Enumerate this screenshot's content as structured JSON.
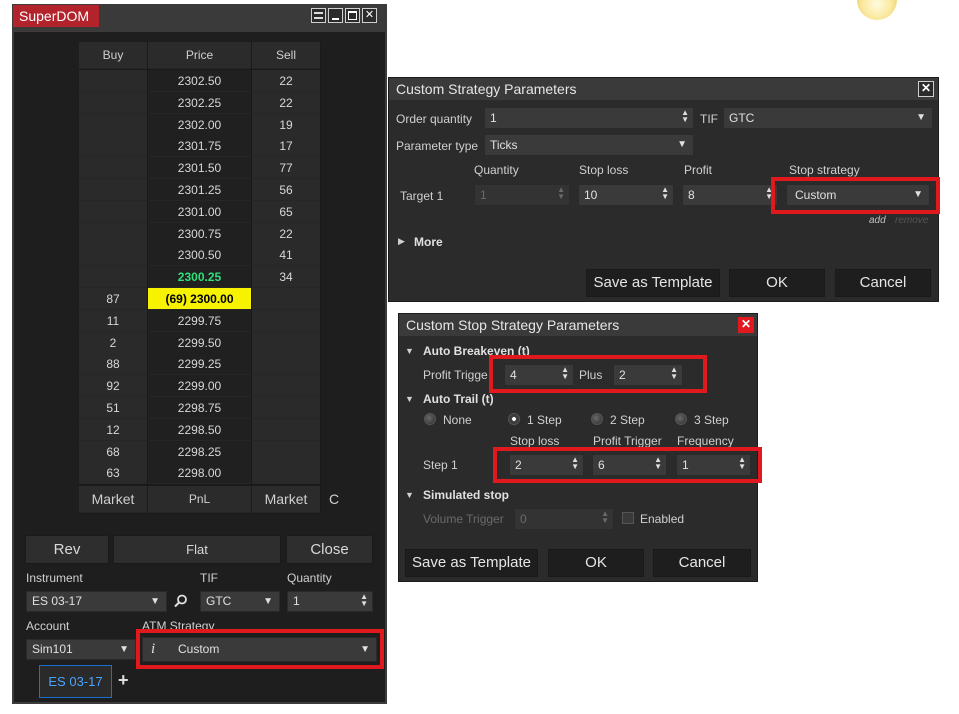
{
  "superdom": {
    "title": "SuperDOM",
    "headers": {
      "buy": "Buy",
      "price": "Price",
      "sell": "Sell"
    },
    "rows": [
      {
        "buy": "",
        "price": "2302.50",
        "sell": "22"
      },
      {
        "buy": "",
        "price": "2302.25",
        "sell": "22"
      },
      {
        "buy": "",
        "price": "2302.00",
        "sell": "19"
      },
      {
        "buy": "",
        "price": "2301.75",
        "sell": "17"
      },
      {
        "buy": "",
        "price": "2301.50",
        "sell": "77"
      },
      {
        "buy": "",
        "price": "2301.25",
        "sell": "56"
      },
      {
        "buy": "",
        "price": "2301.00",
        "sell": "65"
      },
      {
        "buy": "",
        "price": "2300.75",
        "sell": "22"
      },
      {
        "buy": "",
        "price": "2300.50",
        "sell": "41"
      },
      {
        "buy": "",
        "price": "2300.25",
        "sell": "34"
      },
      {
        "buy": "87",
        "price": "(69) 2300.00",
        "sell": ""
      },
      {
        "buy": "11",
        "price": "2299.75",
        "sell": ""
      },
      {
        "buy": "2",
        "price": "2299.50",
        "sell": ""
      },
      {
        "buy": "88",
        "price": "2299.25",
        "sell": ""
      },
      {
        "buy": "92",
        "price": "2299.00",
        "sell": ""
      },
      {
        "buy": "51",
        "price": "2298.75",
        "sell": ""
      },
      {
        "buy": "12",
        "price": "2298.50",
        "sell": ""
      },
      {
        "buy": "68",
        "price": "2298.25",
        "sell": ""
      },
      {
        "buy": "63",
        "price": "2298.00",
        "sell": ""
      }
    ],
    "footer": {
      "market_buy": "Market",
      "pnl": "PnL",
      "market_sell": "Market",
      "c": "C"
    },
    "rev_label": "Rev",
    "flat_label": "Flat",
    "close_label": "Close",
    "instrument_label": "Instrument",
    "instrument_value": "ES 03-17",
    "tif_label": "TIF",
    "tif_value": "GTC",
    "quantity_label": "Quantity",
    "quantity_value": "1",
    "account_label": "Account",
    "account_value": "Sim101",
    "atm_label": "ATM Strategy",
    "atm_value": "Custom",
    "atm_info": "i",
    "tab_label": "ES 03-17",
    "add_tab": "+",
    "colors": {
      "last_price": "#2fe07a",
      "position_highlight": "#f6f200",
      "title_red": "#b3232b",
      "annotation_red": "#e0191f"
    }
  },
  "custom_strategy": {
    "title": "Custom Strategy Parameters",
    "order_quantity_label": "Order quantity",
    "order_quantity_value": "1",
    "tif_label": "TIF",
    "tif_value": "GTC",
    "parameter_type_label": "Parameter type",
    "parameter_type_value": "Ticks",
    "col_quantity": "Quantity",
    "col_stop_loss": "Stop loss",
    "col_profit": "Profit",
    "col_stop_strategy": "Stop strategy",
    "target_label": "Target 1",
    "target_quantity": "1",
    "target_stop_loss": "10",
    "target_profit": "8",
    "target_stop_strategy": "Custom",
    "add_link": "add",
    "remove_link": "remove",
    "more_label": "More",
    "save_template": "Save as Template",
    "ok": "OK",
    "cancel": "Cancel"
  },
  "custom_stop": {
    "title": "Custom Stop Strategy Parameters",
    "auto_breakeven": "Auto Breakeven (t)",
    "profit_trigger_label": "Profit Trigge",
    "profit_trigger_value": "4",
    "plus_label": "Plus",
    "plus_value": "2",
    "auto_trail": "Auto Trail (t)",
    "radio_none": "None",
    "radio_1": "1 Step",
    "radio_2": "2 Step",
    "radio_3": "3 Step",
    "col_stop_loss": "Stop loss",
    "col_profit_trigger": "Profit Trigger",
    "col_frequency": "Frequency",
    "step_label": "Step 1",
    "step_stop_loss": "2",
    "step_profit_trigger": "6",
    "step_frequency": "1",
    "simulated_stop": "Simulated stop",
    "volume_trigger_label": "Volume Trigger",
    "volume_trigger_value": "0",
    "enabled_label": "Enabled",
    "save_template": "Save as Template",
    "ok": "OK",
    "cancel": "Cancel"
  }
}
